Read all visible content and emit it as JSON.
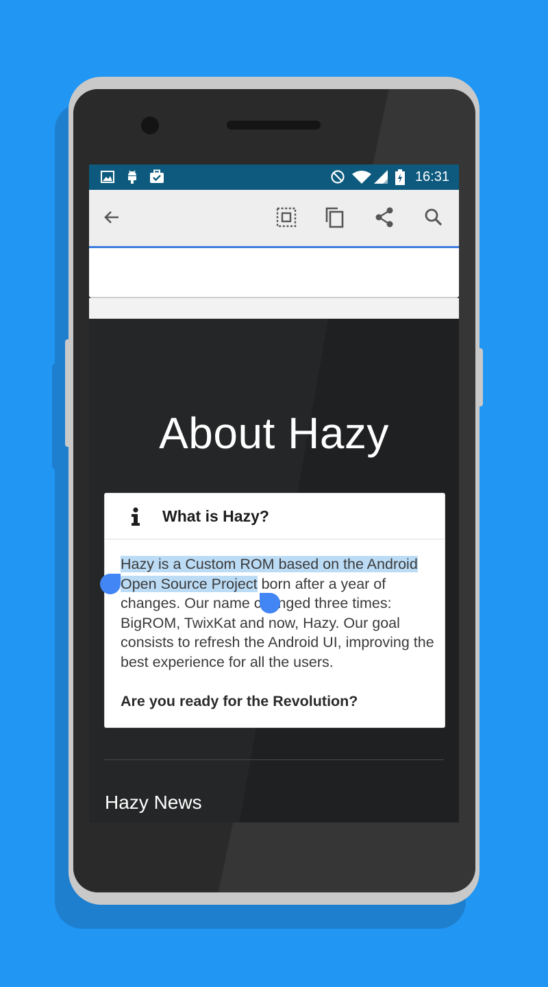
{
  "status_bar": {
    "time": "16:31",
    "left_icons": [
      "image-icon",
      "android-icon",
      "briefcase-check-icon"
    ],
    "right_icons": [
      "do-not-disturb-icon",
      "wifi-icon",
      "signal-icon",
      "battery-charging-icon"
    ]
  },
  "toolbar": {
    "actions": [
      "back-arrow-icon",
      "select-all-icon",
      "copy-icon",
      "share-icon",
      "search-icon"
    ]
  },
  "page": {
    "title": "About Hazy",
    "card": {
      "title": "What is Hazy?",
      "body_selected": "Hazy is a Custom ROM based on the Android Open Source Project",
      "body_rest": " born after a year of changes. Our name changed three times: BigROM, TwixKat and now, Hazy. Our goal consists to refresh the Android UI, improving the best experience for all the users.",
      "question": "Are you ready for the Revolution?"
    },
    "news_title": "Hazy News"
  },
  "colors": {
    "background": "#2196f3",
    "status_bar": "#0d5a7e",
    "selection": "#bcdcf6",
    "selection_handle": "#4285f4",
    "toolbar_accent": "#3b7dde"
  }
}
